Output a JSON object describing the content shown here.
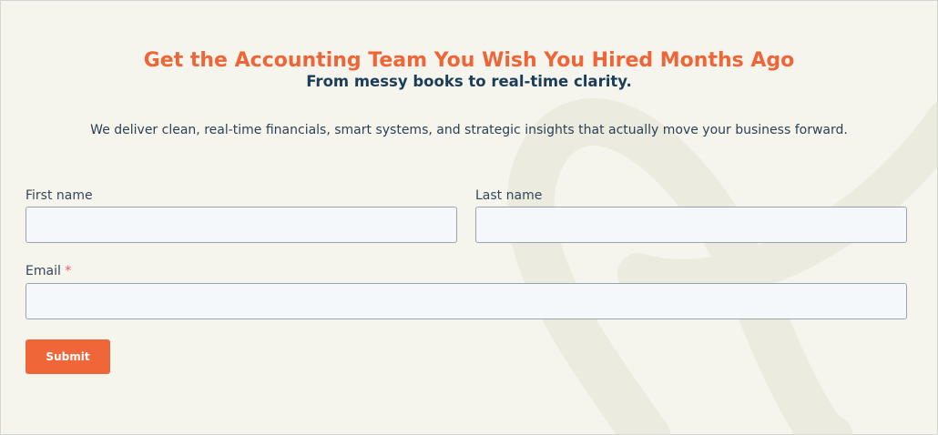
{
  "header": {
    "headline": "Get the Accounting Team You Wish You Hired Months Ago",
    "subheadline": "From messy books to real-time clarity.",
    "description": "We deliver clean, real-time financials, smart systems, and strategic insights that actually move your business forward."
  },
  "form": {
    "first_name": {
      "label": "First name",
      "value": ""
    },
    "last_name": {
      "label": "Last name",
      "value": ""
    },
    "email": {
      "label": "Email",
      "required_marker": "*",
      "value": ""
    },
    "submit_label": "Submit"
  },
  "colors": {
    "background": "#f6f5ed",
    "accent": "#ee6637",
    "navy": "#1c3d57",
    "input_bg": "#f5f8fa",
    "required": "#f2545b",
    "swirl": "#ebe9dd"
  }
}
